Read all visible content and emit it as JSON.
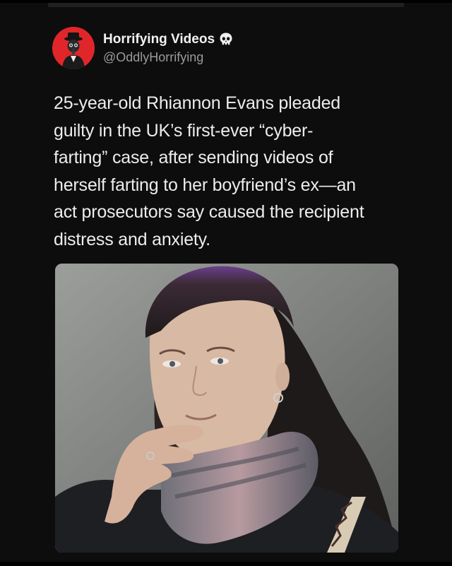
{
  "post": {
    "author": {
      "display_name": "Horrifying Videos",
      "handle": "@OddlyHorrifying",
      "badge_icon": "skull-icon",
      "avatar_color": "#e0262b"
    },
    "text": "25-year-old Rhiannon Evans pleaded\nguilty in the UK’s first-ever “cyber-\nfarting” case, after sending videos of\nherself farting to her boyfriend’s ex—an\nact prosecutors say caused the recipient\ndistress and anxiety.",
    "media": {
      "kind": "photo"
    }
  },
  "theme": {
    "background": "#0d0d0d",
    "text_primary": "#ededed",
    "text_secondary": "#9a9a9a"
  }
}
